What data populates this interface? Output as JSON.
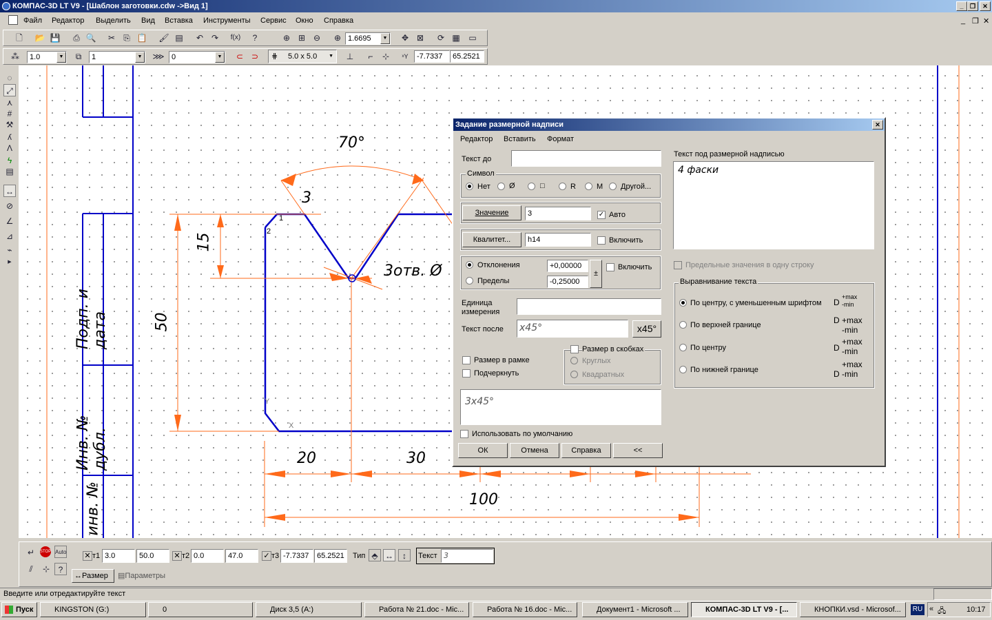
{
  "window": {
    "title": "КОМПАС-3D LT V9 - [Шаблон заготовки.cdw ->Вид 1]"
  },
  "menu": [
    "Файл",
    "Редактор",
    "Выделить",
    "Вид",
    "Вставка",
    "Инструменты",
    "Сервис",
    "Окно",
    "Справка"
  ],
  "toolbar": {
    "zoom": "1.6695"
  },
  "toolbar2": {
    "line_scale": "1.0",
    "layer": "1",
    "style": "0",
    "grid": "5.0 x 5.0",
    "x": "-7.7337",
    "y": "65.2521"
  },
  "drawing": {
    "angle": "70°",
    "chamfer": "3",
    "height15": "15",
    "height50": "50",
    "dim20": "20",
    "dim30": "30",
    "dim100": "100",
    "holes": "3отв. Ø",
    "stamp1": "Подп. и дата",
    "stamp2": "Инв. № дубл.",
    "stamp3": "инв. №",
    "pt1": "1",
    "pt2": "2",
    "axis_x": "X",
    "axis_y": "Y"
  },
  "dialog": {
    "title": "Задание размерной надписи",
    "menu": [
      "Редактор",
      "Вставить",
      "Формат"
    ],
    "text_before_label": "Текст до",
    "text_before": "",
    "symbol_group": "Символ",
    "symbols": [
      "Нет",
      "Ø",
      "□",
      "R",
      "M",
      "Другой..."
    ],
    "value_button": "Значение",
    "value": "3",
    "auto_label": "Авто",
    "qual_button": "Квалитет...",
    "qual": "h14",
    "include_label": "Включить",
    "tolerance_label": "Отклонения",
    "limits_label": "Пределы",
    "upper": "+0,00000",
    "lower": "-0,25000",
    "pm": "±",
    "include2_label": "Включить",
    "unit_label": "Единица измерения",
    "unit": "",
    "text_after_label": "Текст после",
    "text_after": "x45°",
    "x45_button": "x45°",
    "frame_label": "Размер в рамке",
    "underline_label": "Подчеркнуть",
    "brackets_label": "Размер в скобках",
    "round_label": "Круглых",
    "square_label": "Квадратных",
    "preview": "3x45°",
    "default_label": "Использовать по умолчанию",
    "ok": "ОК",
    "cancel": "Отмена",
    "help": "Справка",
    "collapse": "<<",
    "text_under_label": "Текст под размерной надписью",
    "text_under": "4 фаски",
    "limits_one_line": "Предельные значения в одну строку",
    "align_group": "Выравнивание текста",
    "align": [
      "По центру, с уменьшенным шрифтом",
      "По верхней границе",
      "По центру",
      "По нижней границе"
    ],
    "dmark": "D",
    "max": "+max",
    "min": "-min"
  },
  "props": {
    "t1": "т1",
    "t1x": "3.0",
    "t1y": "50.0",
    "t2": "т2",
    "t2x": "0.0",
    "t2y": "47.0",
    "t3": "т3",
    "t3x": "-7.7337",
    "t3y": "65.2521",
    "type_label": "Тип",
    "text_label": "Текст",
    "text_value": "3",
    "tab1": "Размер",
    "tab2": "Параметры"
  },
  "status": "Введите или отредактируйте текст",
  "taskbar": {
    "start": "Пуск",
    "items": [
      "KINGSTON (G:)",
      "0",
      "Диск 3,5 (A:)",
      "Работа № 21.doc - Mic...",
      "Работа № 16.doc - Mic...",
      "Документ1 - Microsoft ...",
      "КОМПАС-3D LT V9 - [...",
      "КНОПКИ.vsd - Microsof..."
    ],
    "lang": "RU",
    "time": "10:17"
  },
  "colors": {
    "accent": "#0a246a",
    "blue_line": "#0000c8",
    "dim_orange": "#ff6a1a"
  }
}
